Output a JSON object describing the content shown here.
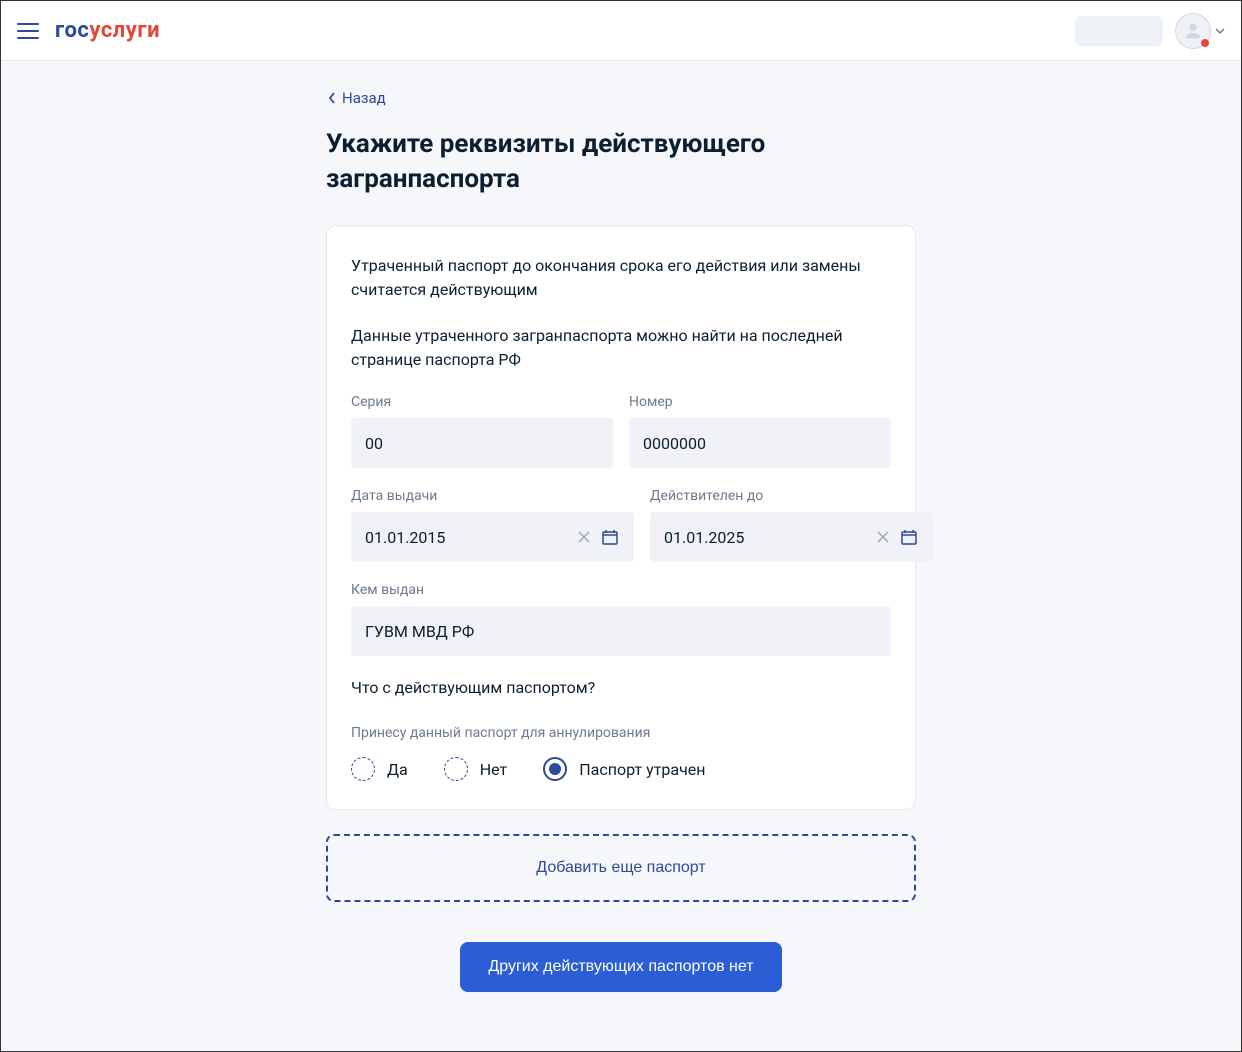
{
  "logo": {
    "part1": "гос",
    "part2": "услуги"
  },
  "backLabel": "Назад",
  "pageTitle": "Укажите реквизиты действующего загранпаспорта",
  "infoText1": "Утраченный паспорт до окончания срока его действия или замены считается действующим",
  "infoText2": "Данные утраченного загранпаспорта можно найти на последней странице паспорта РФ",
  "fields": {
    "seriesLabel": "Серия",
    "seriesValue": "00",
    "numberLabel": "Номер",
    "numberValue": "0000000",
    "issueDateLabel": "Дата выдачи",
    "issueDateValue": "01.01.2015",
    "validUntilLabel": "Действителен до",
    "validUntilValue": "01.01.2025",
    "issuedByLabel": "Кем выдан",
    "issuedByValue": "ГУВМ МВД РФ"
  },
  "questionLabel": "Что с действующим паспортом?",
  "radioGroupLabel": "Принесу данный паспорт для аннулирования",
  "radios": {
    "yes": "Да",
    "no": "Нет",
    "lost": "Паспорт утрачен"
  },
  "addButtonLabel": "Добавить еще паспорт",
  "submitButtonLabel": "Других действующих паспортов нет"
}
